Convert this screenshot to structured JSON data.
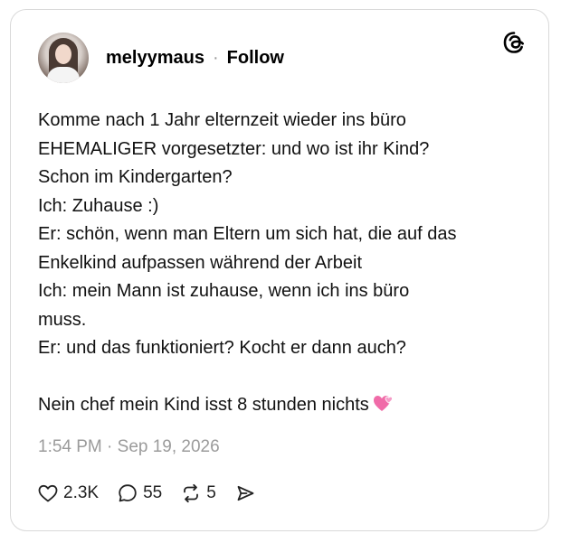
{
  "post": {
    "username": "melyymaus",
    "separator": "·",
    "follow_label": "Follow",
    "lines": [
      "Komme nach 1 Jahr elternzeit wieder ins büro",
      "EHEMALIGER vorgesetzter: und wo ist ihr Kind?",
      "Schon im Kindergarten?",
      "Ich: Zuhause :)",
      "Er: schön, wenn man Eltern um sich hat, die auf das",
      "Enkelkind aufpassen während der Arbeit",
      "Ich: mein Mann ist zuhause, wenn ich ins büro",
      "muss.",
      "Er: und das funktioniert? Kocht er dann auch?",
      "",
      "Nein chef mein Kind isst 8 stunden nichts"
    ],
    "emoji_icon": "two-hearts-icon",
    "timestamp": "1:54 PM · Sep 19, 2026",
    "likes": "2.3K",
    "comments": "55",
    "reposts": "5"
  },
  "icons": {
    "logo": "threads-logo-icon",
    "like": "heart-icon",
    "comment": "comment-bubble-icon",
    "repost": "repost-icon",
    "share": "send-icon"
  },
  "colors": {
    "border": "#d9d9d9",
    "muted_text": "#9b9b9b",
    "emoji_pink": "#f06ba8"
  }
}
